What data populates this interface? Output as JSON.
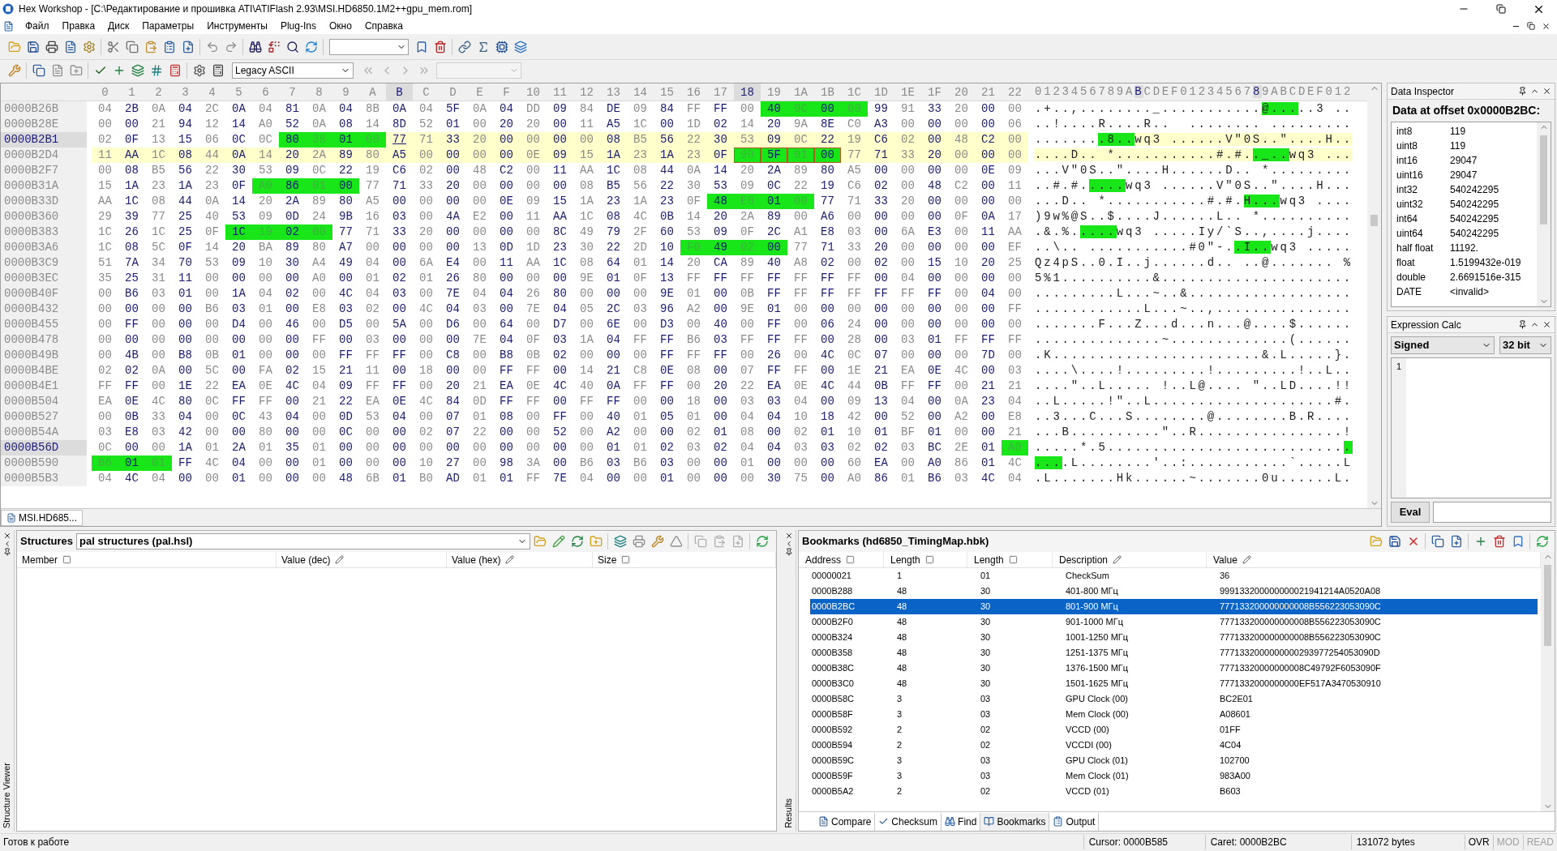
{
  "window": {
    "title": "Hex Workshop - [C:\\Редактирование и прошивка ATI\\ATIFlash 2.93\\MSI.HD6850.1M2++gpu_mem.rom]"
  },
  "menu": [
    "Файл",
    "Правка",
    "Диск",
    "Параметры",
    "Инструменты",
    "Plug-Ins",
    "Окно",
    "Справка"
  ],
  "toolbar": {
    "encoding": "Legacy ASCII"
  },
  "hex_view": {
    "columns": [
      {
        "label": "0",
        "selected": false
      },
      {
        "label": "1",
        "selected": false
      },
      {
        "label": "2",
        "selected": false
      },
      {
        "label": "3",
        "selected": false
      },
      {
        "label": "4",
        "selected": false
      },
      {
        "label": "5",
        "selected": false
      },
      {
        "label": "6",
        "selected": false
      },
      {
        "label": "7",
        "selected": false
      },
      {
        "label": "8",
        "selected": false
      },
      {
        "label": "9",
        "selected": false
      },
      {
        "label": "A",
        "selected": false
      },
      {
        "label": "B",
        "selected": true
      },
      {
        "label": "C",
        "selected": false
      },
      {
        "label": "D",
        "selected": false
      },
      {
        "label": "E",
        "selected": false
      },
      {
        "label": "F",
        "selected": false
      },
      {
        "label": "10",
        "selected": false
      },
      {
        "label": "11",
        "selected": false
      },
      {
        "label": "12",
        "selected": false
      },
      {
        "label": "13",
        "selected": false
      },
      {
        "label": "14",
        "selected": false
      },
      {
        "label": "15",
        "selected": false
      },
      {
        "label": "16",
        "selected": false
      },
      {
        "label": "17",
        "selected": false
      },
      {
        "label": "18",
        "selected": true
      },
      {
        "label": "19",
        "selected": false
      },
      {
        "label": "1A",
        "selected": false
      },
      {
        "label": "1B",
        "selected": false
      },
      {
        "label": "1C",
        "selected": false
      },
      {
        "label": "1D",
        "selected": false
      },
      {
        "label": "1E",
        "selected": false
      },
      {
        "label": "1F",
        "selected": false
      },
      {
        "label": "20",
        "selected": false
      },
      {
        "label": "21",
        "selected": false
      },
      {
        "label": "22",
        "selected": false
      }
    ],
    "ascii_header": "0123456789ABCDEF0123456789ABCDEF012",
    "rows": [
      {
        "offset": "0000B26B",
        "highlighted": false,
        "caret": false,
        "bytes": [
          "04",
          "2B",
          "0A",
          "04",
          "2C",
          "0A",
          "04",
          "81",
          "0A",
          "04",
          "8B",
          "0A",
          "04",
          "5F",
          "0A",
          "04",
          "DD",
          "09",
          "84",
          "DE",
          "09",
          "84",
          "FF",
          "FF",
          "00",
          "40",
          "9C",
          "00",
          "00",
          "99",
          "91",
          "33",
          "20",
          "00",
          "00"
        ],
        "ascii": ".+..,........_...........@.....3 ..",
        "green": [
          false,
          false,
          false,
          false,
          false,
          false,
          false,
          false,
          false,
          false,
          false,
          false,
          false,
          false,
          false,
          false,
          false,
          false,
          false,
          false,
          false,
          false,
          false,
          false,
          false,
          true,
          true,
          true,
          true,
          false,
          false,
          false,
          false,
          false,
          false
        ]
      },
      {
        "offset": "0000B28E",
        "highlighted": false,
        "caret": false,
        "bytes": [
          "00",
          "00",
          "21",
          "94",
          "12",
          "14",
          "A0",
          "52",
          "0A",
          "08",
          "14",
          "8D",
          "52",
          "01",
          "00",
          "20",
          "20",
          "00",
          "11",
          "A5",
          "1C",
          "00",
          "1D",
          "02",
          "14",
          "20",
          "9A",
          "8E",
          "C0",
          "A3",
          "00",
          "00",
          "00",
          "00",
          "06"
        ],
        "ascii": "..!....R....R..  ........ ........."
      },
      {
        "offset": "0000B2B1",
        "highlighted": true,
        "caret": true,
        "selected": [
          false,
          false,
          false,
          false,
          false,
          false,
          false,
          false,
          false,
          false,
          false,
          true,
          true,
          true,
          true,
          true,
          true,
          true,
          true,
          true,
          true,
          true,
          true,
          true,
          true,
          true,
          true,
          true,
          true,
          true,
          true,
          true,
          true,
          true,
          true
        ],
        "bytes": [
          "02",
          "0F",
          "13",
          "15",
          "06",
          "0C",
          "0C",
          "80",
          "38",
          "01",
          "00",
          "77",
          "71",
          "33",
          "20",
          "00",
          "00",
          "00",
          "00",
          "08",
          "B5",
          "56",
          "22",
          "30",
          "53",
          "09",
          "0C",
          "22",
          "19",
          "C6",
          "02",
          "00",
          "48",
          "C2",
          "00"
        ],
        "ascii": "........8..wq3 ......V\"0S..\"....H..",
        "green": [
          false,
          false,
          false,
          false,
          false,
          false,
          false,
          true,
          true,
          true,
          true,
          false,
          false,
          false,
          false,
          false,
          false,
          false,
          false,
          false,
          false,
          false,
          false,
          false,
          false,
          false,
          false,
          false,
          false,
          false,
          false,
          false,
          false,
          false,
          false
        ]
      },
      {
        "offset": "0000B2D4",
        "highlighted": false,
        "caret": false,
        "selected": [
          true,
          true,
          true,
          true,
          true,
          true,
          true,
          true,
          true,
          true,
          true,
          true,
          true,
          true,
          true,
          true,
          true,
          true,
          true,
          true,
          true,
          true,
          true,
          true,
          true,
          true,
          true,
          true,
          true,
          true,
          true,
          true,
          true,
          true,
          true
        ],
        "bytes": [
          "11",
          "AA",
          "1C",
          "08",
          "44",
          "0A",
          "14",
          "20",
          "2A",
          "89",
          "80",
          "A5",
          "00",
          "00",
          "00",
          "00",
          "0E",
          "09",
          "15",
          "1A",
          "23",
          "1A",
          "23",
          "0F",
          "90",
          "5F",
          "01",
          "00",
          "77",
          "71",
          "33",
          "20",
          "00",
          "00",
          "00"
        ],
        "ascii": "....D.. *...........#.#.._..wq3 ...",
        "green": [
          false,
          false,
          false,
          false,
          false,
          false,
          false,
          false,
          false,
          false,
          false,
          false,
          false,
          false,
          false,
          false,
          false,
          false,
          false,
          false,
          false,
          false,
          false,
          false,
          true,
          true,
          true,
          true,
          false,
          false,
          false,
          false,
          false,
          false,
          false
        ]
      },
      {
        "offset": "0000B2F7",
        "highlighted": false,
        "caret": false,
        "bytes": [
          "00",
          "08",
          "B5",
          "56",
          "22",
          "30",
          "53",
          "09",
          "0C",
          "22",
          "19",
          "C6",
          "02",
          "00",
          "48",
          "C2",
          "00",
          "11",
          "AA",
          "1C",
          "08",
          "44",
          "0A",
          "14",
          "20",
          "2A",
          "89",
          "80",
          "A5",
          "00",
          "00",
          "00",
          "00",
          "0E",
          "09"
        ],
        "ascii": "...V\"0S..\"....H......D.. *........."
      },
      {
        "offset": "0000B31A",
        "highlighted": false,
        "caret": false,
        "bytes": [
          "15",
          "1A",
          "23",
          "1A",
          "23",
          "0F",
          "A0",
          "86",
          "01",
          "00",
          "77",
          "71",
          "33",
          "20",
          "00",
          "00",
          "00",
          "00",
          "08",
          "B5",
          "56",
          "22",
          "30",
          "53",
          "09",
          "0C",
          "22",
          "19",
          "C6",
          "02",
          "00",
          "48",
          "C2",
          "00",
          "11"
        ],
        "ascii": "..#.#.....wq3 ......V\"0S..\"....H...",
        "green": [
          false,
          false,
          false,
          false,
          false,
          false,
          true,
          true,
          true,
          true,
          false,
          false,
          false,
          false,
          false,
          false,
          false,
          false,
          false,
          false,
          false,
          false,
          false,
          false,
          false,
          false,
          false,
          false,
          false,
          false,
          false,
          false,
          false,
          false,
          false
        ]
      },
      {
        "offset": "0000B33D",
        "highlighted": false,
        "caret": false,
        "bytes": [
          "AA",
          "1C",
          "08",
          "44",
          "0A",
          "14",
          "20",
          "2A",
          "89",
          "80",
          "A5",
          "00",
          "00",
          "00",
          "00",
          "0E",
          "09",
          "15",
          "1A",
          "23",
          "1A",
          "23",
          "0F",
          "48",
          "E8",
          "01",
          "00",
          "77",
          "71",
          "33",
          "20",
          "00",
          "00",
          "00",
          "00"
        ],
        "ascii": "...D.. *...........#.#.H...wq3 ....",
        "green": [
          false,
          false,
          false,
          false,
          false,
          false,
          false,
          false,
          false,
          false,
          false,
          false,
          false,
          false,
          false,
          false,
          false,
          false,
          false,
          false,
          false,
          false,
          false,
          true,
          true,
          true,
          true,
          false,
          false,
          false,
          false,
          false,
          false,
          false,
          false
        ]
      },
      {
        "offset": "0000B360",
        "highlighted": false,
        "caret": false,
        "bytes": [
          "29",
          "39",
          "77",
          "25",
          "40",
          "53",
          "09",
          "0D",
          "24",
          "9B",
          "16",
          "03",
          "00",
          "4A",
          "E2",
          "00",
          "11",
          "AA",
          "1C",
          "08",
          "4C",
          "0B",
          "14",
          "20",
          "2A",
          "89",
          "00",
          "A6",
          "00",
          "00",
          "00",
          "00",
          "0F",
          "0A",
          "17"
        ],
        "ascii": ")9w%@S..$....J......L.. *.........."
      },
      {
        "offset": "0000B383",
        "highlighted": false,
        "caret": false,
        "bytes": [
          "1C",
          "26",
          "1C",
          "25",
          "0F",
          "1C",
          "19",
          "02",
          "00",
          "77",
          "71",
          "33",
          "20",
          "00",
          "00",
          "00",
          "00",
          "8C",
          "49",
          "79",
          "2F",
          "60",
          "53",
          "09",
          "0F",
          "2C",
          "A1",
          "E8",
          "03",
          "00",
          "6A",
          "E3",
          "00",
          "11",
          "AA"
        ],
        "ascii": ".&.%.....wq3 .....Iy/`S..,....j....",
        "green": [
          false,
          false,
          false,
          false,
          false,
          true,
          true,
          true,
          true,
          false,
          false,
          false,
          false,
          false,
          false,
          false,
          false,
          false,
          false,
          false,
          false,
          false,
          false,
          false,
          false,
          false,
          false,
          false,
          false,
          false,
          false,
          false,
          false,
          false,
          false
        ]
      },
      {
        "offset": "0000B3A6",
        "highlighted": false,
        "caret": false,
        "bytes": [
          "1C",
          "08",
          "5C",
          "0F",
          "14",
          "20",
          "BA",
          "89",
          "80",
          "A7",
          "00",
          "00",
          "00",
          "00",
          "13",
          "0D",
          "1D",
          "23",
          "30",
          "22",
          "2D",
          "10",
          "F0",
          "49",
          "02",
          "00",
          "77",
          "71",
          "33",
          "20",
          "00",
          "00",
          "00",
          "00",
          "EF"
        ],
        "ascii": "..\\.. ...........#0\"-..I..wq3 .....",
        "green": [
          false,
          false,
          false,
          false,
          false,
          false,
          false,
          false,
          false,
          false,
          false,
          false,
          false,
          false,
          false,
          false,
          false,
          false,
          false,
          false,
          false,
          false,
          true,
          true,
          true,
          true,
          false,
          false,
          false,
          false,
          false,
          false,
          false,
          false,
          false
        ]
      },
      {
        "offset": "0000B3C9",
        "highlighted": false,
        "caret": false,
        "bytes": [
          "51",
          "7A",
          "34",
          "70",
          "53",
          "09",
          "10",
          "30",
          "A4",
          "49",
          "04",
          "00",
          "6A",
          "E4",
          "00",
          "11",
          "AA",
          "1C",
          "08",
          "64",
          "01",
          "14",
          "20",
          "CA",
          "89",
          "40",
          "A8",
          "02",
          "00",
          "02",
          "00",
          "15",
          "10",
          "20",
          "25"
        ],
        "ascii": "Qz4pS..0.I..j......d.. ..@....... %"
      },
      {
        "offset": "0000B3EC",
        "highlighted": false,
        "caret": false,
        "bytes": [
          "35",
          "25",
          "31",
          "11",
          "00",
          "00",
          "00",
          "00",
          "A0",
          "00",
          "01",
          "02",
          "01",
          "26",
          "80",
          "00",
          "00",
          "00",
          "9E",
          "01",
          "0F",
          "13",
          "FF",
          "FF",
          "FF",
          "FF",
          "FF",
          "FF",
          "FF",
          "00",
          "04",
          "00",
          "00",
          "00",
          "00"
        ],
        "ascii": "5%1..........&....................."
      },
      {
        "offset": "0000B40F",
        "highlighted": false,
        "caret": false,
        "bytes": [
          "00",
          "B6",
          "03",
          "01",
          "00",
          "1A",
          "04",
          "02",
          "00",
          "4C",
          "04",
          "03",
          "00",
          "7E",
          "04",
          "04",
          "26",
          "80",
          "00",
          "00",
          "00",
          "9E",
          "01",
          "00",
          "0B",
          "FF",
          "FF",
          "FF",
          "FF",
          "FF",
          "FF",
          "FF",
          "00",
          "04",
          "00"
        ],
        "ascii": ".........L...~..&.................."
      },
      {
        "offset": "0000B432",
        "highlighted": false,
        "caret": false,
        "bytes": [
          "00",
          "00",
          "00",
          "00",
          "B6",
          "03",
          "01",
          "00",
          "E8",
          "03",
          "02",
          "00",
          "4C",
          "04",
          "03",
          "00",
          "7E",
          "04",
          "05",
          "2C",
          "03",
          "96",
          "A2",
          "00",
          "9E",
          "01",
          "00",
          "00",
          "00",
          "00",
          "00",
          "00",
          "00",
          "00",
          "FF"
        ],
        "ascii": "............L...~..,..............."
      },
      {
        "offset": "0000B455",
        "highlighted": false,
        "caret": false,
        "bytes": [
          "00",
          "FF",
          "00",
          "00",
          "00",
          "D4",
          "00",
          "46",
          "00",
          "D5",
          "00",
          "5A",
          "00",
          "D6",
          "00",
          "64",
          "00",
          "D7",
          "00",
          "6E",
          "00",
          "D3",
          "00",
          "40",
          "00",
          "FF",
          "00",
          "06",
          "24",
          "00",
          "00",
          "00",
          "00",
          "00",
          "00"
        ],
        "ascii": ".......F...Z...d...n...@....$......"
      },
      {
        "offset": "0000B478",
        "highlighted": false,
        "caret": false,
        "bytes": [
          "00",
          "00",
          "00",
          "00",
          "00",
          "00",
          "00",
          "00",
          "FF",
          "00",
          "03",
          "00",
          "00",
          "00",
          "7E",
          "04",
          "0F",
          "03",
          "1A",
          "04",
          "FF",
          "FF",
          "B6",
          "03",
          "FF",
          "FF",
          "FF",
          "00",
          "28",
          "00",
          "03",
          "01",
          "FF",
          "FF",
          "FF"
        ],
        "ascii": "..............~.............(......"
      },
      {
        "offset": "0000B49B",
        "highlighted": false,
        "caret": false,
        "bytes": [
          "00",
          "4B",
          "00",
          "B8",
          "0B",
          "01",
          "00",
          "00",
          "00",
          "FF",
          "FF",
          "FF",
          "00",
          "C8",
          "00",
          "B8",
          "0B",
          "02",
          "00",
          "00",
          "00",
          "FF",
          "FF",
          "FF",
          "00",
          "26",
          "00",
          "4C",
          "0C",
          "07",
          "00",
          "00",
          "00",
          "7D",
          "00"
        ],
        "ascii": ".K.......................&.L.....}."
      },
      {
        "offset": "0000B4BE",
        "highlighted": false,
        "caret": false,
        "bytes": [
          "02",
          "02",
          "0A",
          "00",
          "5C",
          "00",
          "FA",
          "02",
          "15",
          "21",
          "11",
          "00",
          "18",
          "00",
          "00",
          "FF",
          "FF",
          "00",
          "14",
          "21",
          "C8",
          "0E",
          "08",
          "00",
          "07",
          "FF",
          "FF",
          "00",
          "1E",
          "21",
          "EA",
          "0E",
          "4C",
          "00",
          "03"
        ],
        "ascii": "....\\....!.........!.........!..L.."
      },
      {
        "offset": "0000B4E1",
        "highlighted": false,
        "caret": false,
        "bytes": [
          "FF",
          "FF",
          "00",
          "1E",
          "22",
          "EA",
          "0E",
          "4C",
          "04",
          "09",
          "FF",
          "FF",
          "00",
          "20",
          "21",
          "EA",
          "0E",
          "4C",
          "40",
          "0A",
          "FF",
          "FF",
          "00",
          "20",
          "22",
          "EA",
          "0E",
          "4C",
          "44",
          "0B",
          "FF",
          "FF",
          "00",
          "21",
          "21"
        ],
        "ascii": "....\"..L..... !..L@.... \"..LD....!!"
      },
      {
        "offset": "0000B504",
        "highlighted": false,
        "caret": false,
        "bytes": [
          "EA",
          "0E",
          "4C",
          "80",
          "0C",
          "FF",
          "FF",
          "00",
          "21",
          "22",
          "EA",
          "0E",
          "4C",
          "84",
          "0D",
          "FF",
          "FF",
          "00",
          "FF",
          "FF",
          "00",
          "00",
          "18",
          "00",
          "03",
          "03",
          "04",
          "00",
          "09",
          "13",
          "04",
          "00",
          "0A",
          "23",
          "04"
        ],
        "ascii": "..L.....!\"..L....................#."
      },
      {
        "offset": "0000B527",
        "highlighted": false,
        "caret": false,
        "bytes": [
          "00",
          "0B",
          "33",
          "04",
          "00",
          "0C",
          "43",
          "04",
          "00",
          "0D",
          "53",
          "04",
          "00",
          "07",
          "01",
          "08",
          "00",
          "FF",
          "00",
          "40",
          "01",
          "05",
          "01",
          "00",
          "04",
          "04",
          "10",
          "18",
          "42",
          "00",
          "52",
          "00",
          "A2",
          "00",
          "E8"
        ],
        "ascii": "..3...C...S........@........B.R...."
      },
      {
        "offset": "0000B54A",
        "highlighted": false,
        "caret": false,
        "bytes": [
          "03",
          "E8",
          "03",
          "42",
          "00",
          "00",
          "80",
          "00",
          "00",
          "0C",
          "00",
          "00",
          "02",
          "07",
          "22",
          "00",
          "00",
          "52",
          "00",
          "A2",
          "00",
          "00",
          "02",
          "01",
          "08",
          "00",
          "02",
          "01",
          "10",
          "01",
          "BF",
          "01",
          "00",
          "00",
          "21"
        ],
        "ascii": "...B..........\"..R................!"
      },
      {
        "offset": "0000B56D",
        "highlighted": true,
        "caret": false,
        "bytes": [
          "0C",
          "00",
          "00",
          "1A",
          "01",
          "2A",
          "01",
          "35",
          "01",
          "00",
          "00",
          "00",
          "00",
          "00",
          "00",
          "00",
          "00",
          "00",
          "00",
          "01",
          "01",
          "02",
          "03",
          "02",
          "04",
          "04",
          "03",
          "03",
          "02",
          "02",
          "03",
          "BC",
          "2E",
          "01",
          "A0"
        ],
        "ascii": ".....*.5...........................",
        "green": [
          false,
          false,
          false,
          false,
          false,
          false,
          false,
          false,
          false,
          false,
          false,
          false,
          false,
          false,
          false,
          false,
          false,
          false,
          false,
          false,
          false,
          false,
          false,
          false,
          false,
          false,
          false,
          false,
          false,
          false,
          false,
          false,
          false,
          false,
          true
        ]
      },
      {
        "offset": "0000B590",
        "highlighted": false,
        "caret": false,
        "bytes": [
          "B6",
          "01",
          "01",
          "FF",
          "4C",
          "04",
          "00",
          "00",
          "01",
          "00",
          "00",
          "00",
          "10",
          "27",
          "00",
          "98",
          "3A",
          "00",
          "B6",
          "03",
          "B6",
          "03",
          "00",
          "00",
          "01",
          "00",
          "00",
          "00",
          "60",
          "EA",
          "00",
          "A0",
          "86",
          "01",
          "4C"
        ],
        "ascii": "....L........'..:...........`.....L",
        "green": [
          true,
          true,
          true,
          false,
          false,
          false,
          false,
          false,
          false,
          false,
          false,
          false,
          false,
          false,
          false,
          false,
          false,
          false,
          false,
          false,
          false,
          false,
          false,
          false,
          false,
          false,
          false,
          false,
          false,
          false,
          false,
          false,
          false,
          false,
          false
        ]
      },
      {
        "offset": "0000B5B3",
        "highlighted": false,
        "caret": false,
        "bytes": [
          "04",
          "4C",
          "04",
          "00",
          "00",
          "01",
          "00",
          "00",
          "00",
          "48",
          "6B",
          "01",
          "B0",
          "AD",
          "01",
          "01",
          "FF",
          "7E",
          "04",
          "00",
          "00",
          "01",
          "00",
          "00",
          "00",
          "30",
          "75",
          "00",
          "A0",
          "86",
          "01",
          "B6",
          "03",
          "4C",
          "04"
        ],
        "ascii": ".L.......Hk......~.......0u......L."
      }
    ]
  },
  "document_tab": "MSI.HD685...",
  "data_inspector": {
    "title": "Data Inspector",
    "heading": "Data at offset 0x0000B2BC:",
    "rows": [
      {
        "type": "int8",
        "value": "119"
      },
      {
        "type": "uint8",
        "value": "119"
      },
      {
        "type": "int16",
        "value": "29047"
      },
      {
        "type": "uint16",
        "value": "29047"
      },
      {
        "type": "int32",
        "value": "540242295"
      },
      {
        "type": "uint32",
        "value": "540242295"
      },
      {
        "type": "int64",
        "value": "540242295"
      },
      {
        "type": "uint64",
        "value": "540242295"
      },
      {
        "type": "half float",
        "value": "11192."
      },
      {
        "type": "float",
        "value": "1.5199432e-019"
      },
      {
        "type": "double",
        "value": "2.6691516e-315"
      },
      {
        "type": "DATE",
        "value": "<invalid>"
      }
    ]
  },
  "expression_calc": {
    "title": "Expression Calc",
    "sign": "Signed",
    "width": "32 bit",
    "line_number": "1",
    "eval_button": "Eval"
  },
  "structures": {
    "side_label": "Structure Viewer",
    "title": "Structures",
    "library": "pal structures (pal.hsl)",
    "columns": [
      "Member",
      "Value (dec)",
      "Value (hex)",
      "Size"
    ]
  },
  "bookmarks": {
    "side_label": "Results",
    "title": "Bookmarks (hd6850_TimingMap.hbk)",
    "columns": [
      "Address",
      "Length",
      "Length",
      "Description",
      "Value"
    ],
    "rows": [
      {
        "address": "00000021",
        "length": "1",
        "length_hex": "01",
        "description": "CheckSum",
        "value": "36",
        "selected": false
      },
      {
        "address": "0000B288",
        "length": "48",
        "length_hex": "30",
        "description": "401-800 МГц",
        "value": "999133200000000021941214A0520A08",
        "selected": false
      },
      {
        "address": "0000B2BC",
        "length": "48",
        "length_hex": "30",
        "description": "801-900 МГц",
        "value": "777133200000000008B556223053090C",
        "selected": true
      },
      {
        "address": "0000B2F0",
        "length": "48",
        "length_hex": "30",
        "description": "901-1000 МГц",
        "value": "777133200000000008B556223053090C",
        "selected": false
      },
      {
        "address": "0000B324",
        "length": "48",
        "length_hex": "30",
        "description": "1001-1250 МГц",
        "value": "777133200000000008B556223053090C",
        "selected": false
      },
      {
        "address": "0000B358",
        "length": "48",
        "length_hex": "30",
        "description": "1251-1375 МГц",
        "value": "7771332000000000293977254053090D",
        "selected": false
      },
      {
        "address": "0000B38C",
        "length": "48",
        "length_hex": "30",
        "description": "1376-1500 МГц",
        "value": "77713320000000008C49792F6053090F",
        "selected": false
      },
      {
        "address": "0000B3C0",
        "length": "48",
        "length_hex": "30",
        "description": "1501-1625 МГц",
        "value": "7771332000000000EF517A3470530910",
        "selected": false
      },
      {
        "address": "0000B58C",
        "length": "3",
        "length_hex": "03",
        "description": "GPU Clock (00)",
        "value": "BC2E01",
        "selected": false
      },
      {
        "address": "0000B58F",
        "length": "3",
        "length_hex": "03",
        "description": "Mem Clock (00)",
        "value": "A08601",
        "selected": false
      },
      {
        "address": "0000B592",
        "length": "2",
        "length_hex": "02",
        "description": "VCCD (00)",
        "value": "01FF",
        "selected": false
      },
      {
        "address": "0000B594",
        "length": "2",
        "length_hex": "02",
        "description": "VCCDI (00)",
        "value": "4C04",
        "selected": false
      },
      {
        "address": "0000B59C",
        "length": "3",
        "length_hex": "03",
        "description": "GPU Clock (01)",
        "value": "102700",
        "selected": false
      },
      {
        "address": "0000B59F",
        "length": "3",
        "length_hex": "03",
        "description": "Mem Clock (01)",
        "value": "983A00",
        "selected": false
      },
      {
        "address": "0000B5A2",
        "length": "2",
        "length_hex": "02",
        "description": "VCCD (01)",
        "value": "B603",
        "selected": false
      }
    ],
    "tabs": [
      {
        "label": "Compare",
        "selected": false
      },
      {
        "label": "Checksum",
        "selected": false
      },
      {
        "label": "Find",
        "selected": false
      },
      {
        "label": "Bookmarks",
        "selected": true
      },
      {
        "label": "Output",
        "selected": false
      }
    ]
  },
  "status_bar": {
    "message": "Готов к работе",
    "cursor": "Cursor: 0000B585",
    "caret": "Caret: 0000B2BC",
    "size": "131072 bytes",
    "modes": [
      {
        "label": "OVR",
        "active": true
      },
      {
        "label": "MOD",
        "active": false
      },
      {
        "label": "READ",
        "active": false
      }
    ]
  }
}
